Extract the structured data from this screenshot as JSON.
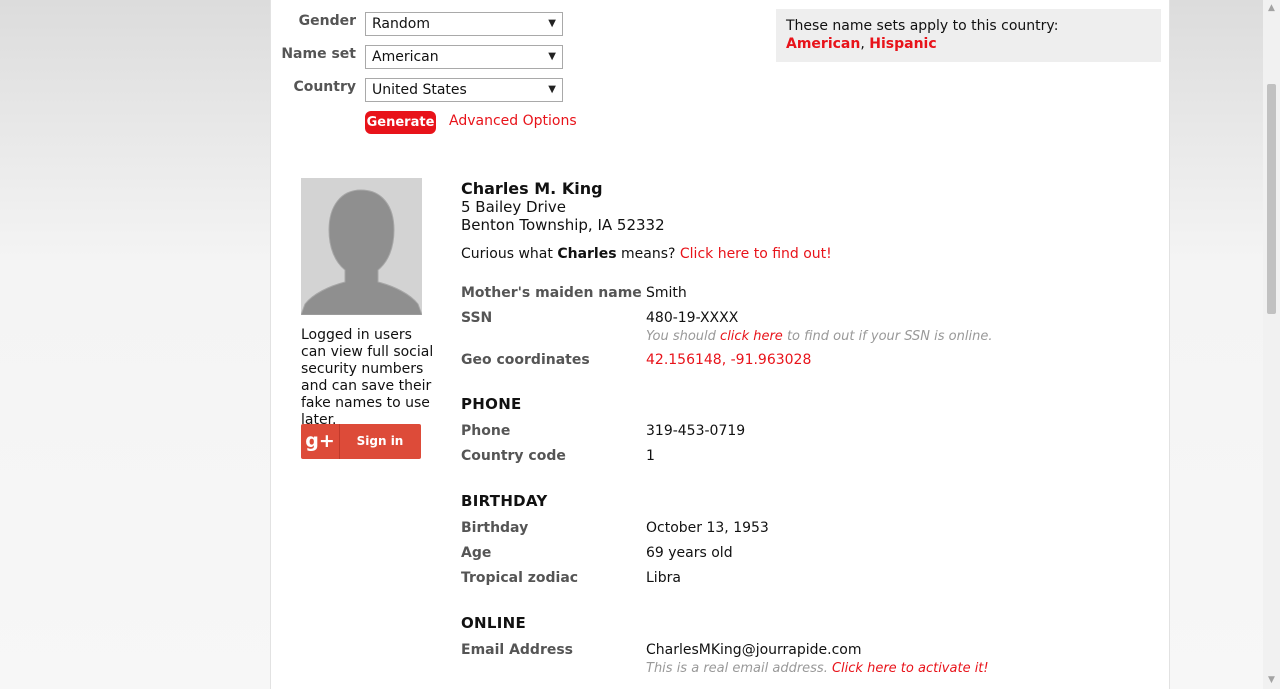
{
  "form": {
    "gender_label": "Gender",
    "gender_value": "Random",
    "nameset_label": "Name set",
    "nameset_value": "American",
    "country_label": "Country",
    "country_value": "United States",
    "generate_label": "Generate",
    "advanced_label": "Advanced Options"
  },
  "nameset_box": {
    "text": "These name sets apply to this country:",
    "sets": [
      "American",
      "Hispanic"
    ],
    "separator": ", "
  },
  "sidebar": {
    "login_text": "Logged in users can view full social security numbers and can save their fake names to use later.",
    "gplus_icon": "g+",
    "signin_label": "Sign in"
  },
  "person": {
    "name": "Charles M. King",
    "address_line1": "5 Bailey Drive",
    "address_line2": "Benton Township, IA 52332",
    "curious_prefix": "Curious what ",
    "first_name": "Charles",
    "curious_suffix": " means? ",
    "curious_link": "Click here to find out!"
  },
  "details": {
    "maiden_label": "Mother's maiden name",
    "maiden_value": "Smith",
    "ssn_label": "SSN",
    "ssn_value": "480-19-XXXX",
    "ssn_note_prefix": "You should ",
    "ssn_note_link": "click here",
    "ssn_note_suffix": " to find out if your SSN is online.",
    "geo_label": "Geo coordinates",
    "geo_value": "42.156148, -91.963028"
  },
  "phone": {
    "heading": "PHONE",
    "phone_label": "Phone",
    "phone_value": "319-453-0719",
    "cc_label": "Country code",
    "cc_value": "1"
  },
  "birthday": {
    "heading": "BIRTHDAY",
    "birthday_label": "Birthday",
    "birthday_value": "October 13, 1953",
    "age_label": "Age",
    "age_value": "69 years old",
    "zodiac_label": "Tropical zodiac",
    "zodiac_value": "Libra"
  },
  "online": {
    "heading": "ONLINE",
    "email_label": "Email Address",
    "email_value": "CharlesMKing@jourrapide.com",
    "email_note_prefix": "This is a real email address. ",
    "email_note_link": "Click here to activate it!"
  },
  "icons": {
    "caret": "chevron-down-icon",
    "avatar": "person-silhouette-icon",
    "google": "google-plus-icon"
  },
  "colors": {
    "accent": "#e8131a",
    "google": "#dd4b39",
    "box_bg": "#eeeeee"
  }
}
